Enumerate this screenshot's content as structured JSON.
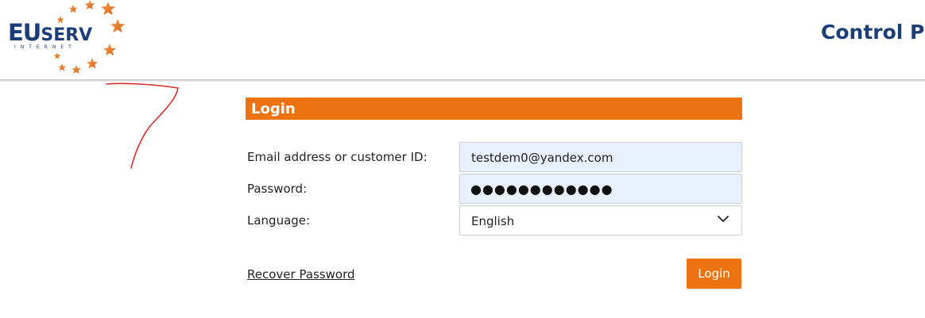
{
  "brand": {
    "logo_main": "EU",
    "logo_rest": "SERV",
    "logo_sub": "INTERNET",
    "primary_color": "#1c3e78",
    "accent_color": "#ed7210"
  },
  "header": {
    "title": "Control P"
  },
  "login": {
    "heading": "Login",
    "email_label": "Email address or customer ID:",
    "email_value": "testdem0@yandex.com",
    "password_label": "Password:",
    "password_mask": "●●●●●●●●●●●●",
    "language_label": "Language:",
    "language_value": "English",
    "recover_label": "Recover Password",
    "submit_label": "Login"
  },
  "icons": {
    "logo_stars": "star-icon",
    "language_chevron": "chevron-down-icon"
  }
}
